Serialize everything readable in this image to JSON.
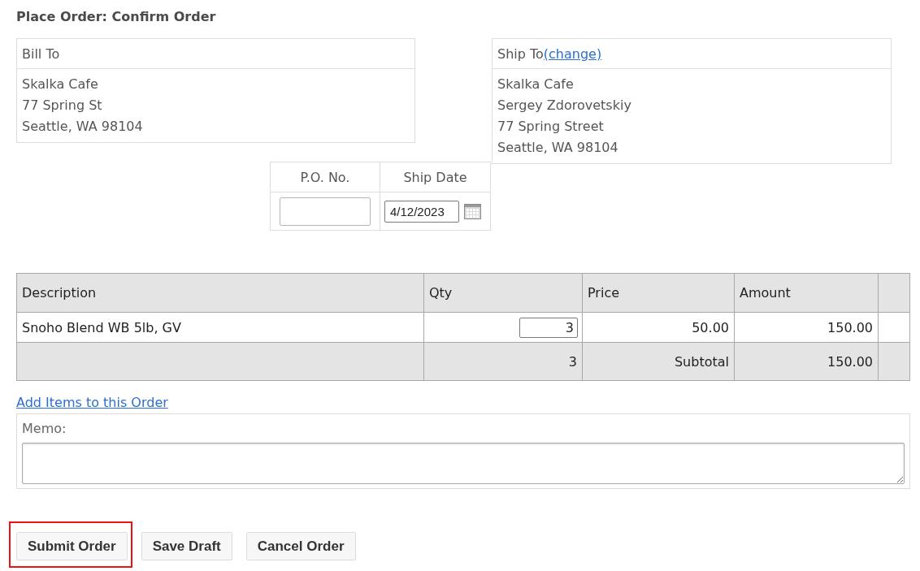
{
  "title": "Place Order: Confirm Order",
  "bill_to": {
    "heading": "Bill To",
    "lines": [
      "Skalka Cafe",
      "77 Spring St",
      "Seattle, WA 98104"
    ]
  },
  "ship_to": {
    "heading": "Ship To",
    "change_link": "(change)",
    "lines": [
      "Skalka Cafe",
      "Sergey Zdorovetskiy",
      "77 Spring Street",
      "Seattle, WA 98104"
    ]
  },
  "order_fields": [
    {
      "label": "P.O. No.",
      "kind": "text"
    },
    {
      "label": "Ship Date",
      "kind": "date",
      "value": "4/12/2023"
    }
  ],
  "items": {
    "columns": [
      "Description",
      "Qty",
      "Price",
      "Amount"
    ],
    "rows": [
      {
        "description": "Snoho Blend WB 5lb, GV",
        "qty": "3",
        "price": "50.00",
        "amount": "150.00"
      }
    ],
    "footer": {
      "qty": "3",
      "label": "Subtotal",
      "amount": "150.00"
    }
  },
  "add_items_link": "Add Items to this Order",
  "memo": {
    "label": "Memo:"
  },
  "buttons": [
    {
      "label": "Submit Order",
      "highlighted": true
    },
    {
      "label": "Save Draft",
      "highlighted": false
    },
    {
      "label": "Cancel Order",
      "highlighted": false
    }
  ]
}
